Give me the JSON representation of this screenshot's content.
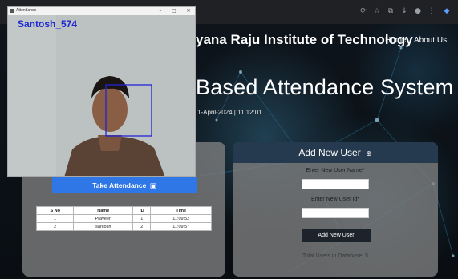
{
  "site": {
    "title": "yana Raju Institute of Technology",
    "nav": [
      "Home",
      "About Us"
    ],
    "hero_title": "Based Attendance System",
    "date_time": "1-April-2024 | 11:12:01"
  },
  "camera_window": {
    "title": "Attendance",
    "controls": [
      "–",
      "□",
      "✕"
    ],
    "recognized_name": "Santosh_574"
  },
  "attendance": {
    "button_label": "Take Attendance",
    "button_icon": "calendar-icon",
    "columns": [
      "S No",
      "Name",
      "ID",
      "Time"
    ],
    "rows": [
      [
        "1",
        "Praveen",
        "1",
        "11:09:52"
      ],
      [
        "2",
        "santosh",
        "2",
        "11:09:57"
      ]
    ]
  },
  "add_user": {
    "header": "Add New User",
    "header_icon": "user-plus-icon",
    "name_label": "Enter New User Name*",
    "name_value": "",
    "id_label": "Enter New User Id*",
    "id_value": "",
    "button_label": "Add New User",
    "total_users": "Total Users in Database: 5"
  },
  "colors": {
    "accent_blue": "#2f77e6",
    "panel_header": "#263a4f",
    "face_box": "#2323d6"
  }
}
